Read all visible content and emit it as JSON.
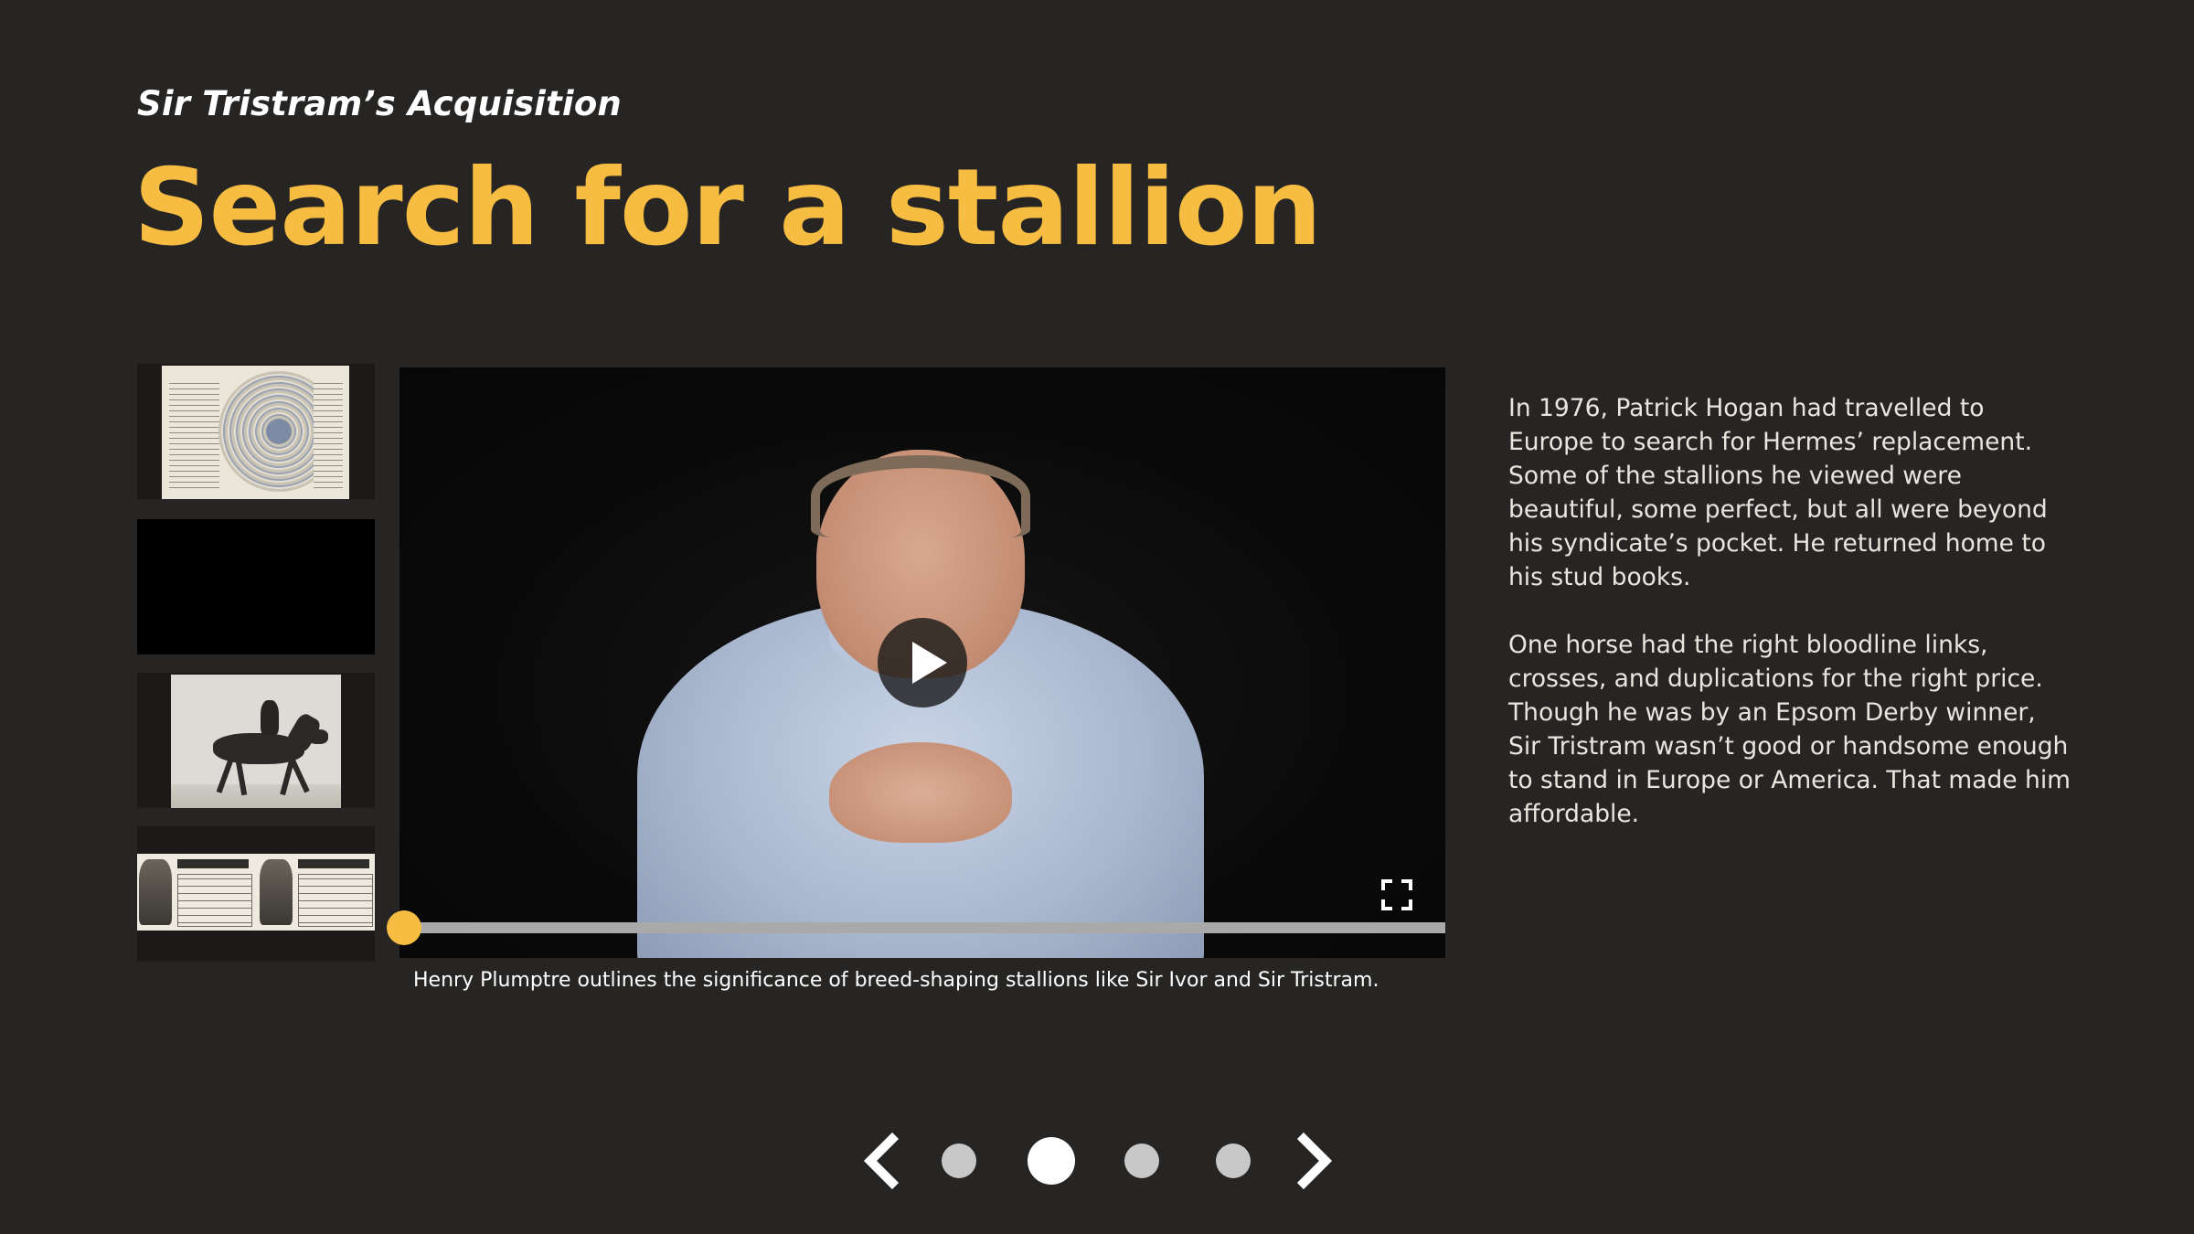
{
  "header": {
    "eyebrow": "Sir Tristram’s Acquisition",
    "title": "Search for a stallion"
  },
  "thumbnails": [
    {
      "name": "stud-book-pedigree-chart",
      "active": false
    },
    {
      "name": "video-thumbnail",
      "active": true
    },
    {
      "name": "race-horse-photo",
      "active": false
    },
    {
      "name": "race-programme",
      "active": false
    }
  ],
  "video": {
    "caption": "Henry Plumptre outlines the significance of breed-shaping stallions like Sir Ivor and Sir Tristram.",
    "progress": 0.0,
    "play_icon": "play-icon",
    "fullscreen_icon": "fullscreen-icon"
  },
  "body": {
    "paragraphs": [
      "In 1976, Patrick Hogan had travelled to Europe to search for Hermes’ replacement. Some of the stallions he viewed were beautiful, some perfect, but all were beyond his syndicate’s pocket. He returned home to his stud books.",
      "One horse had the right bloodline links, crosses, and duplications for the right price. Though he was by an Epsom Derby winner, Sir Tristram wasn’t good or handsome enough to stand in Europe or America. That made him affordable."
    ]
  },
  "pagination": {
    "total": 4,
    "current": 2,
    "prev_icon": "chevron-left-icon",
    "next_icon": "chevron-right-icon"
  },
  "colors": {
    "background": "#262523",
    "accent": "#f7bd42",
    "text": "#e9e6e0"
  }
}
